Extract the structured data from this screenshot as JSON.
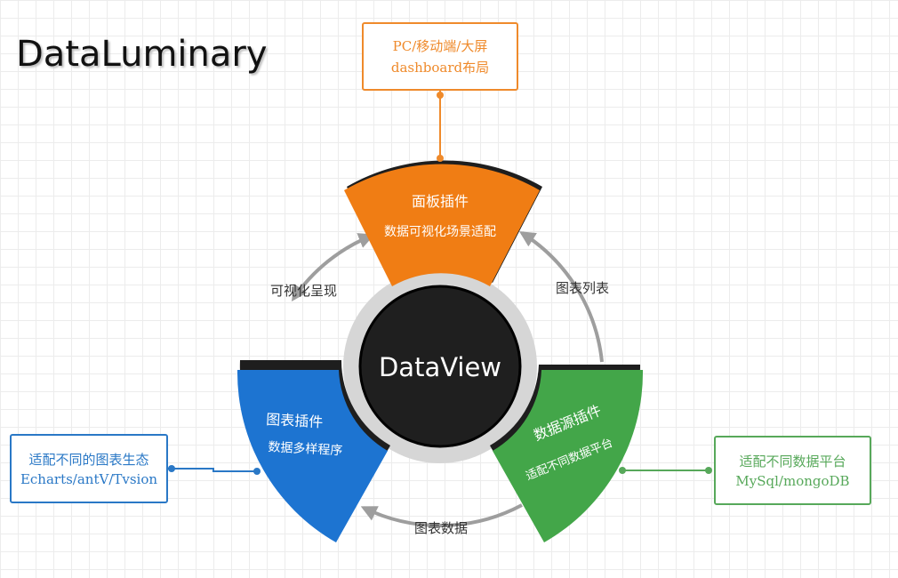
{
  "brand": {
    "title": "DataLuminary"
  },
  "core": {
    "label": "DataView"
  },
  "segments": {
    "panel": {
      "title": "面板插件",
      "subtitle": "数据可视化场景适配",
      "color": "#f07d14"
    },
    "chart": {
      "title": "图表插件",
      "subtitle": "数据多样程序",
      "color": "#1d74d1"
    },
    "datasource": {
      "title": "数据源插件",
      "subtitle": "适配不同数据平台",
      "color": "#43a649"
    }
  },
  "boxes": {
    "top": {
      "line1": "PC/移动端/大屏",
      "line2": "dashboard布局"
    },
    "left": {
      "line1": "适配不同的图表生态",
      "line2": "Echarts/antV/Tvsion"
    },
    "right": {
      "line1": "适配不同数据平台",
      "line2": "MySql/mongoDB"
    }
  },
  "arrows": {
    "chart_to_panel": "可视化呈现",
    "datasource_to_panel": "图表列表",
    "datasource_to_chart": "图表数据"
  }
}
